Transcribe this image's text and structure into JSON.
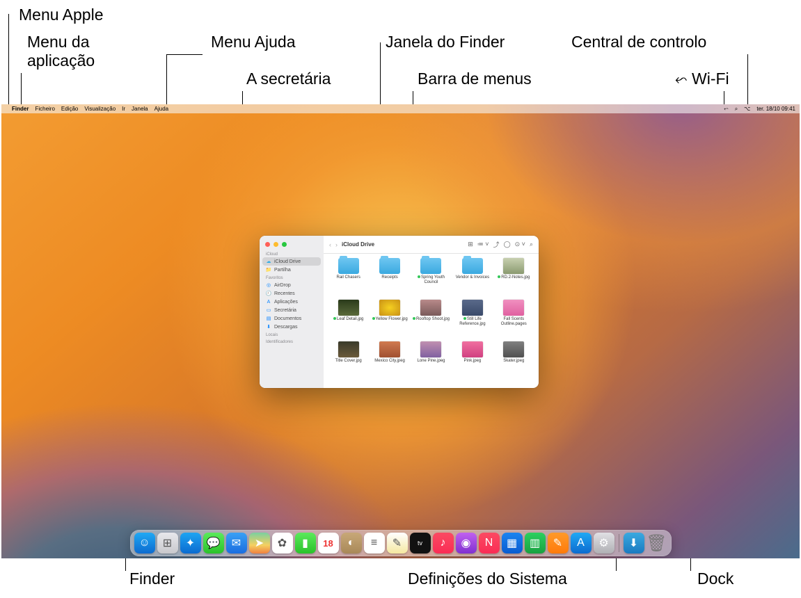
{
  "callouts": {
    "apple_menu": "Menu Apple",
    "app_menu": "Menu da\naplicação",
    "help_menu": "Menu Ajuda",
    "desktop": "A secretária",
    "finder_window": "Janela do Finder",
    "menu_bar": "Barra de menus",
    "control_center": "Central de controlo",
    "wifi": "Wi-Fi",
    "finder_dock": "Finder",
    "system_settings": "Definições do Sistema",
    "dock": "Dock"
  },
  "menubar": {
    "app": "Finder",
    "items": [
      "Ficheiro",
      "Edição",
      "Visualização",
      "Ir",
      "Janela",
      "Ajuda"
    ],
    "datetime": "ter. 18/10  09:41"
  },
  "finder": {
    "title": "iCloud Drive",
    "sidebar": {
      "sections": [
        {
          "label": "iCloud",
          "items": [
            {
              "label": "iCloud Drive",
              "icon": "☁︎",
              "selected": true,
              "color": "c-cyan"
            },
            {
              "label": "Partilha",
              "icon": "📁",
              "color": "c-cyan"
            }
          ]
        },
        {
          "label": "Favoritos",
          "items": [
            {
              "label": "AirDrop",
              "icon": "◎",
              "color": "c-blue"
            },
            {
              "label": "Recentes",
              "icon": "🕘",
              "color": "c-blue"
            },
            {
              "label": "Aplicações",
              "icon": "A",
              "color": "c-blue"
            },
            {
              "label": "Secretária",
              "icon": "▭",
              "color": "c-blue"
            },
            {
              "label": "Documentos",
              "icon": "▤",
              "color": "c-blue"
            },
            {
              "label": "Descargas",
              "icon": "⬇︎",
              "color": "c-blue"
            }
          ]
        },
        {
          "label": "Locais",
          "items": []
        },
        {
          "label": "Identificadores",
          "items": []
        }
      ]
    },
    "files": [
      {
        "name": "Rail Chasers",
        "type": "folder"
      },
      {
        "name": "Receipts",
        "type": "folder"
      },
      {
        "name": "Spring Youth Council",
        "type": "folder",
        "tag": true
      },
      {
        "name": "Vendor & Invoices",
        "type": "folder"
      },
      {
        "name": "RD.2-Notes.jpg",
        "type": "thumb",
        "bg": "linear-gradient(#c8d0b0,#8a9a70)",
        "tag": true
      },
      {
        "name": "Leaf Detail.jpg",
        "type": "thumb",
        "bg": "linear-gradient(#2a3a1a,#5a6a3a)",
        "tag": true
      },
      {
        "name": "Yellow Flower.jpg",
        "type": "thumb",
        "bg": "radial-gradient(#f5d020,#c99015)",
        "tag": true
      },
      {
        "name": "Rooftop Shoot.jpg",
        "type": "thumb",
        "bg": "linear-gradient(#b88a8a,#7a5a5a)",
        "tag": true
      },
      {
        "name": "Still Life Reference.jpg",
        "type": "thumb",
        "bg": "linear-gradient(#5a6a8a,#3a4a6a)",
        "tag": true
      },
      {
        "name": "Fall Scents Outline.pages",
        "type": "thumb",
        "bg": "linear-gradient(#f090c0,#e060a0)"
      },
      {
        "name": "Title Cover.jpg",
        "type": "thumb",
        "bg": "linear-gradient(#3a3a2a,#6a5a3a)"
      },
      {
        "name": "Mexico City.jpeg",
        "type": "thumb",
        "bg": "linear-gradient(#d07a50,#a05030)"
      },
      {
        "name": "Lone Pine.jpeg",
        "type": "thumb",
        "bg": "linear-gradient(#c090b0,#8060a0)"
      },
      {
        "name": "Pink.jpeg",
        "type": "thumb",
        "bg": "linear-gradient(#f070a0,#d04080)"
      },
      {
        "name": "Skater.jpeg",
        "type": "thumb",
        "bg": "linear-gradient(#808080,#505050)"
      }
    ]
  },
  "dock": {
    "items": [
      {
        "name": "finder",
        "bg": "linear-gradient(#1fa8f4,#0d6bcf)",
        "glyph": "☺"
      },
      {
        "name": "launchpad",
        "bg": "linear-gradient(#e8e8ec,#c8c8cc)",
        "glyph": "⊞"
      },
      {
        "name": "safari",
        "bg": "linear-gradient(#1ea4f2,#0b6bd0)",
        "glyph": "✦"
      },
      {
        "name": "messages",
        "bg": "linear-gradient(#5bea5b,#2bc22b)",
        "glyph": "💬"
      },
      {
        "name": "mail",
        "bg": "linear-gradient(#3aa0f5,#1a6de0)",
        "glyph": "✉︎"
      },
      {
        "name": "maps",
        "bg": "linear-gradient(#7ad0a0,#f5d060 60%,#f08040)",
        "glyph": "➤"
      },
      {
        "name": "photos",
        "bg": "#fff",
        "glyph": "✿"
      },
      {
        "name": "facetime",
        "bg": "linear-gradient(#5bea5b,#2bc22b)",
        "glyph": "▮"
      },
      {
        "name": "calendar",
        "bg": "#fff",
        "glyph": "18"
      },
      {
        "name": "contacts",
        "bg": "linear-gradient(#c8a878,#a88858)",
        "glyph": "◐"
      },
      {
        "name": "reminders",
        "bg": "#fff",
        "glyph": "≡"
      },
      {
        "name": "notes",
        "bg": "linear-gradient(#fff,#f5e8a0)",
        "glyph": "✎"
      },
      {
        "name": "tv",
        "bg": "#111",
        "glyph": "tv"
      },
      {
        "name": "music",
        "bg": "linear-gradient(#fb4a62,#fa2d55)",
        "glyph": "♪"
      },
      {
        "name": "podcasts",
        "bg": "linear-gradient(#c060f0,#8030d0)",
        "glyph": "◉"
      },
      {
        "name": "news",
        "bg": "linear-gradient(#fb4a62,#fa2d55)",
        "glyph": "N"
      },
      {
        "name": "keynote",
        "bg": "linear-gradient(#1a84f0,#0a5cd0)",
        "glyph": "▦"
      },
      {
        "name": "numbers",
        "bg": "linear-gradient(#2bd060,#1aa040)",
        "glyph": "▥"
      },
      {
        "name": "pages",
        "bg": "linear-gradient(#ff9a2a,#ff7a0a)",
        "glyph": "✎"
      },
      {
        "name": "appstore",
        "bg": "linear-gradient(#1fa8f4,#0d6bcf)",
        "glyph": "A"
      },
      {
        "name": "system-settings",
        "bg": "linear-gradient(#e0e0e4,#b0b0b4)",
        "glyph": "⚙︎"
      }
    ],
    "right": [
      {
        "name": "downloads",
        "bg": "linear-gradient(#3aa9e0,#1a7ac0)",
        "glyph": "⬇︎"
      },
      {
        "name": "trash",
        "bg": "linear-gradient(#e0e0e4,#b8b8bc)",
        "glyph": "🗑"
      }
    ]
  }
}
